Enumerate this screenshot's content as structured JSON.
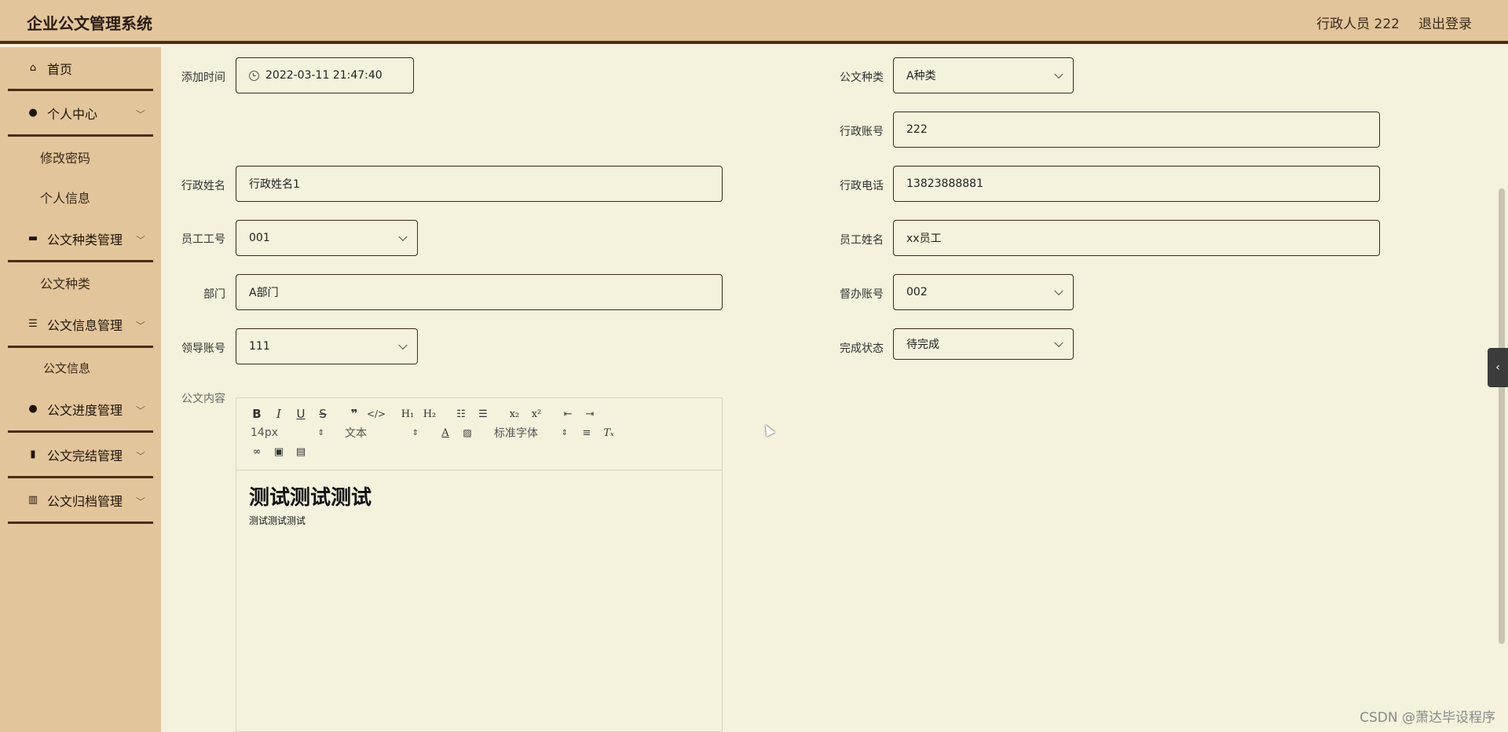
{
  "header": {
    "app_title": "企业公文管理系统",
    "user_label": "行政人员 222",
    "logout_label": "退出登录"
  },
  "sidebar": {
    "home": "首页",
    "personal_center": "个人中心",
    "change_password": "修改密码",
    "personal_info": "个人信息",
    "doc_type_mgmt": "公文种类管理",
    "doc_type": "公文种类",
    "doc_info_mgmt": "公文信息管理",
    "doc_info": "公文信息",
    "doc_progress_mgmt": "公文进度管理",
    "doc_complete_mgmt": "公文完结管理",
    "doc_archive_mgmt": "公文归档管理"
  },
  "form": {
    "add_time_label": "添加时间",
    "add_time_value": "2022-03-11 21:47:40",
    "doc_type_label": "公文种类",
    "doc_type_value": "A种类",
    "admin_account_label": "行政账号",
    "admin_account_value": "222",
    "admin_name_label": "行政姓名",
    "admin_name_value": "行政姓名1",
    "admin_phone_label": "行政电话",
    "admin_phone_value": "13823888881",
    "emp_no_label": "员工工号",
    "emp_no_value": "001",
    "emp_name_label": "员工姓名",
    "emp_name_value": "xx员工",
    "dept_label": "部门",
    "dept_value": "A部门",
    "supervisor_label": "督办账号",
    "supervisor_value": "002",
    "leader_label": "领导账号",
    "leader_value": "111",
    "status_label": "完成状态",
    "status_value": "待完成",
    "content_label": "公文内容"
  },
  "editor": {
    "font_size": "14px",
    "text_style": "文本",
    "font_family": "标准字体",
    "content_heading": "测试测试测试",
    "content_body": "测试测试测试"
  },
  "watermark": "CSDN @萧达毕设程序"
}
